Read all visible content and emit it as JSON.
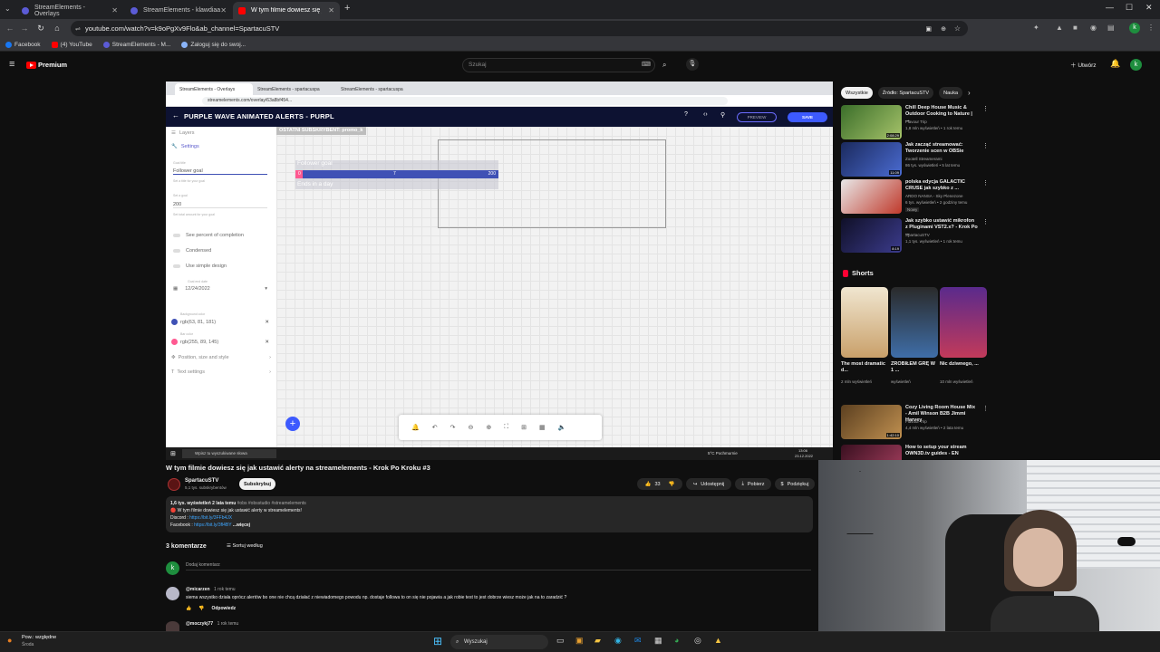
{
  "browser": {
    "tabs": [
      {
        "label": "StreamElements - Overlays",
        "color": "#5b5bd6"
      },
      {
        "label": "StreamElements - klawdiaa",
        "color": "#5b5bd6"
      },
      {
        "label": "W tym filmie dowiesz się ja",
        "color": "#ff0000"
      }
    ],
    "new_tab": "+",
    "url": "youtube.com/watch?v=k9oPgXv9Flo&ab_channel=SpartacuSTV",
    "bookmarks": [
      "Facebook",
      "(4) YouTube",
      "StreamElements - M...",
      "Zaloguj się do swoj..."
    ]
  },
  "youtube": {
    "logo": "Premium",
    "search_placeholder": "Szukaj",
    "create_label": "Utwórz",
    "avatar_letter": "k",
    "filters": [
      "Wszystkie",
      "Źródło: SpartacuSTV",
      "Nauka"
    ],
    "video_title": "W tym filmie dowiesz się jak ustawić alerty na streamelements - Krok Po Kroku #3",
    "channel": {
      "name": "SpartacuSTV",
      "subs": "5,1 tys. subskrybentów",
      "subscribe": "Subskrybuj"
    },
    "actions": {
      "likes": "33",
      "share": "Udostępnij",
      "download": "Pobierz",
      "save": "Podziękuj"
    },
    "description": {
      "meta": "1,6 tys. wyświetleń  2 lata temu",
      "tags": "#obs #obsstudio #streamelements",
      "line1": "W tym filmie dowiesz się jak ustawić alerty w streamelements!",
      "line2_label": "Discord :",
      "line2_link": "https://bit.ly/3FFb4JX",
      "line3_label": "Facebook :",
      "line3_link": "https://bit.ly/3fl4BY",
      "more": "...więcej"
    },
    "comments": {
      "count": "3 komentarze",
      "sort": "Sortuj według",
      "add": "Dodaj komentarz",
      "items": [
        {
          "author": "@micarzen",
          "time": "1 rok temu",
          "text": "siema wszystko działa oprócz alertów bo one nie chcą działać z niewiadomego powodu np. dostaje followa to on się nie pojawia a jak robie test to jest dobrze wiesz może jak na to zaradzić ?",
          "reply": "Odpowiedz"
        },
        {
          "author": "@moczykj77",
          "time": "1 rok temu"
        }
      ]
    },
    "recommendations": [
      {
        "title": "Chill Deep House Music & Outdoor Cooking to Nature | ...",
        "channel": "Flavour Trip",
        "meta": "1,8 mln wyświetleń • 1 rok temu",
        "duration": "2:08:29",
        "color": "#5b8c3a"
      },
      {
        "title": "Jak zacząć streamować: Tworzenie scen w OBSie",
        "channel": "Zootell Streamerami",
        "meta": "86 tys. wyświetleń • 5 lat temu",
        "duration": "11:09",
        "color": "#2a3e7c"
      },
      {
        "title": "polska edycja GALACTIC CRUSE jak szybko z ...",
        "channel": "ARDO NANSA - Sky Plenezone",
        "meta": "6 tys. wyświetleń • 2 godziny temu",
        "badge": "Nowy",
        "duration": "",
        "color": "#b83b2c"
      },
      {
        "title": "Jak szybko ustawić mikrofon z Pluginami VST2.x? - Krok Po ...",
        "channel": "SpartacuSTV",
        "meta": "1,1 tys. wyświetleń • 1 rok temu",
        "duration": "8:19",
        "color": "#1c1c3c"
      },
      {
        "title": "Cozy Living Room House Mix - Amil Winson B2B Jimmi Harvey",
        "channel": "Flavour Trip",
        "meta": "4,4 mln wyświetleń • 2 lata temu",
        "duration": "1:42:10",
        "color": "#8c6a3a"
      },
      {
        "title": "How to setup your stream OWN3D.tv guides - EN",
        "channel": "",
        "meta": "",
        "duration": "",
        "color": "#6b2c3a"
      }
    ],
    "shorts_label": "Shorts",
    "shorts": [
      {
        "title": "The most dramatic d...",
        "meta": "2 mln wyświetleń",
        "color": "#c9a06a"
      },
      {
        "title": "ZROBIŁEM GRĘ W 1 ...",
        "meta": "wyświetleń",
        "color": "#3f6ea8"
      },
      {
        "title": "Nic dziwnego, ...",
        "meta": "10 mln wyświetleń",
        "color": "#c23a5a"
      }
    ]
  },
  "video_frame": {
    "inner_tabs": [
      "StreamElements - Overlays",
      "StreamElements - spartacuspa",
      "StreamElements - spartacuspa"
    ],
    "inner_url": "streamelements.com/overlay/63a8bf454...",
    "editor_title": "PURPLE WAVE ANIMATED ALERTS - PURPL",
    "preview": "PREVIEW",
    "save": "SAVE",
    "left_panel": {
      "layers": "Layers",
      "settings": "Settings",
      "goal_title_label": "Goal title",
      "goal_title_value": "Follower goal",
      "goal_title_hint": "Set a title for your goal",
      "goal_label": "Set a goal",
      "goal_value": "200",
      "goal_hint": "Set total amount for your goal",
      "toggles": [
        "See percent of completion",
        "Condensed",
        "Use simple design"
      ],
      "end_date_label": "Goal end date",
      "end_date": "12/24/2022",
      "bg_color_label": "Background color",
      "bg_color": "rgb(63, 81, 181)",
      "bar_color_label": "Bar color",
      "bar_color": "rgb(255, 89, 145)",
      "sections": [
        "Position, size and style",
        "Text settings"
      ]
    },
    "canvas": {
      "latest_sub": "OSTATNI SUBSKRYBENT: promo_k",
      "goal_title": "Follower goal",
      "bar_start": "0",
      "bar_current": "7",
      "bar_end": "200",
      "bar_fraction": 0.035,
      "ends_text": "Ends in a day"
    },
    "taskbar_search": "Wpisz tu wyszukiwane słowa",
    "weather": "5°C  Pochmurnie",
    "clock": "13:06",
    "date": "23.12.2022"
  },
  "windows": {
    "weather": "Pow.: względne",
    "weather_sub": "Środa",
    "search": "Wyszukaj"
  }
}
